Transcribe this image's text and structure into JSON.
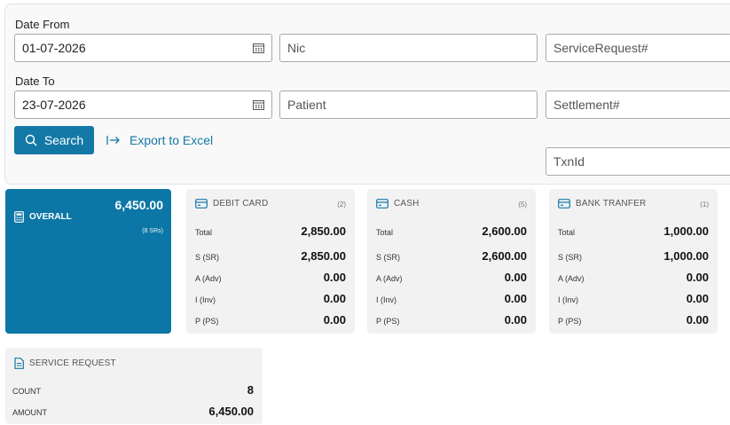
{
  "filters": {
    "date_from_label": "Date From",
    "date_from_value": "01-07-2026",
    "date_to_label": "Date To",
    "date_to_value": "23-07-2026",
    "nic_placeholder": "Nic",
    "patient_placeholder": "Patient",
    "service_request_placeholder": "ServiceRequest#",
    "settlement_placeholder": "Settlement#",
    "txnid_placeholder": "TxnId",
    "search_label": "Search",
    "export_label": "Export to Excel"
  },
  "overall": {
    "title": "OVERALL",
    "total": "6,450.00",
    "subtitle": "(8 SRs)"
  },
  "cards": [
    {
      "title": "DEBIT CARD",
      "count": "(2)",
      "rows": [
        {
          "k": "Total",
          "v": "2,850.00"
        },
        {
          "k": "S (SR)",
          "v": "2,850.00"
        },
        {
          "k": "A (Adv)",
          "v": "0.00"
        },
        {
          "k": "I (Inv)",
          "v": "0.00"
        },
        {
          "k": "P (PS)",
          "v": "0.00"
        }
      ]
    },
    {
      "title": "CASH",
      "count": "(5)",
      "rows": [
        {
          "k": "Total",
          "v": "2,600.00"
        },
        {
          "k": "S (SR)",
          "v": "2,600.00"
        },
        {
          "k": "A (Adv)",
          "v": "0.00"
        },
        {
          "k": "I (Inv)",
          "v": "0.00"
        },
        {
          "k": "P (PS)",
          "v": "0.00"
        }
      ]
    },
    {
      "title": "BANK TRANFER",
      "count": "(1)",
      "rows": [
        {
          "k": "Total",
          "v": "1,000.00"
        },
        {
          "k": "S (SR)",
          "v": "1,000.00"
        },
        {
          "k": "A (Adv)",
          "v": "0.00"
        },
        {
          "k": "I (Inv)",
          "v": "0.00"
        },
        {
          "k": "P (PS)",
          "v": "0.00"
        }
      ]
    }
  ],
  "service_request": {
    "title": "SERVICE REQUEST",
    "count_label": "COUNT",
    "count_value": "8",
    "amount_label": "AMOUNT",
    "amount_value": "6,450.00"
  },
  "colors": {
    "accent": "#1478a6",
    "overall_bg": "#0c77a6"
  },
  "icons": [
    "calendar-icon",
    "search-icon",
    "export-icon",
    "calculator-icon",
    "credit-card-icon",
    "document-icon"
  ]
}
